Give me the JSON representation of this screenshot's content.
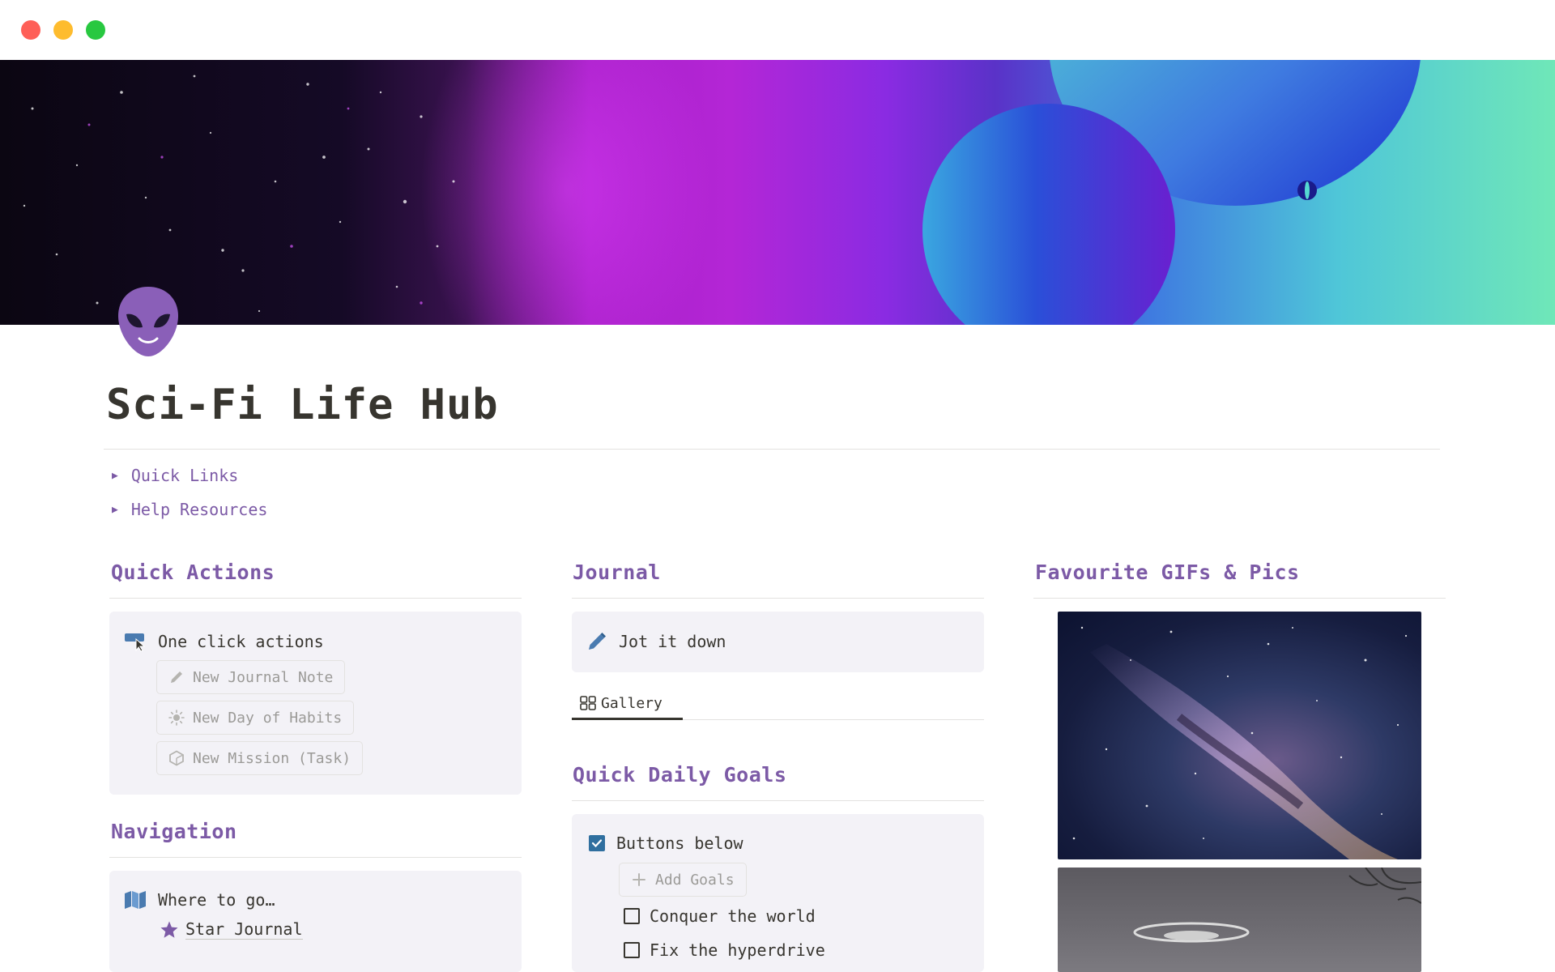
{
  "page": {
    "title": "Sci-Fi Life Hub",
    "icon": "alien-icon"
  },
  "toggles": [
    {
      "label": "Quick Links"
    },
    {
      "label": "Help Resources"
    }
  ],
  "quick_actions": {
    "heading": "Quick Actions",
    "callout_label": "One click actions",
    "callout_icon": "pointer-hand-icon",
    "buttons": [
      {
        "label": "New Journal Note",
        "icon": "pencil-icon"
      },
      {
        "label": "New Day of Habits",
        "icon": "sun-icon"
      },
      {
        "label": "New Mission (Task)",
        "icon": "cube-icon"
      }
    ]
  },
  "navigation": {
    "heading": "Navigation",
    "callout_label": "Where to go…",
    "callout_icon": "map-icon",
    "links": [
      {
        "label": "Star Journal",
        "icon": "star-icon"
      }
    ]
  },
  "journal": {
    "heading": "Journal",
    "callout_label": "Jot it down",
    "callout_icon": "pencil-icon",
    "view_tab": "Gallery"
  },
  "daily_goals": {
    "heading": "Quick Daily Goals",
    "callout_label": "Buttons below",
    "add_button": "Add Goals",
    "todos": [
      {
        "label": "Conquer the world",
        "checked": false
      },
      {
        "label": "Fix the hyperdrive",
        "checked": false
      }
    ]
  },
  "favourites": {
    "heading": "Favourite GIFs & Pics"
  },
  "colors": {
    "accent": "#7c5aa6",
    "callout_bg": "#f3f2f7",
    "checkbox_blue": "#2f6f9f"
  }
}
